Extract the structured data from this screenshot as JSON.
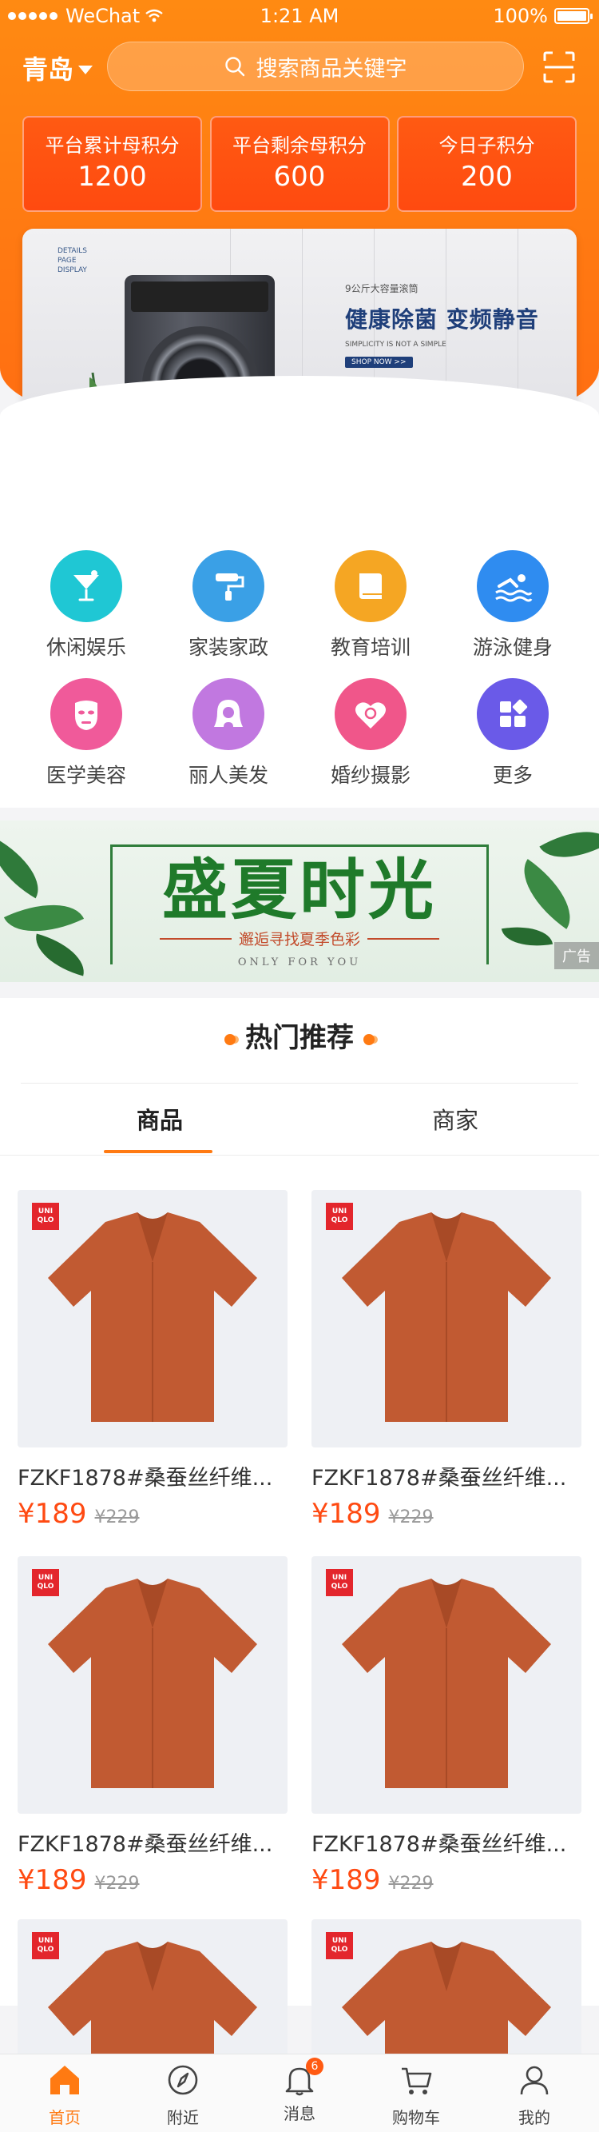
{
  "status_bar": {
    "carrier": "WeChat",
    "time": "1:21 AM",
    "battery": "100%"
  },
  "header": {
    "city": "青岛",
    "search_placeholder": "搜索商品关键字",
    "icons": {
      "search": "search-icon",
      "scan": "scan-icon",
      "dropdown": "triangle-down-icon"
    }
  },
  "points": [
    {
      "label": "平台累计母积分",
      "value": "1200"
    },
    {
      "label": "平台剩余母积分",
      "value": "600"
    },
    {
      "label": "今日子积分",
      "value": "200"
    }
  ],
  "banner": {
    "corner_text_1": "DETAILS",
    "corner_text_2": "PAGE",
    "corner_text_3": "DISPLAY",
    "small_line": "9公斤大容量滚筒",
    "slogan": "健康除菌 变频静音",
    "slogan_en": "SIMPLICITY IS NOT A SIMPLE",
    "button": "SHOP NOW >>"
  },
  "categories": [
    {
      "name": "休闲娱乐",
      "icon": "cocktail-icon",
      "color": "#1fc7d4"
    },
    {
      "name": "家装家政",
      "icon": "paint-roller-icon",
      "color": "#3aa0e6"
    },
    {
      "name": "教育培训",
      "icon": "book-icon",
      "color": "#f5a623"
    },
    {
      "name": "游泳健身",
      "icon": "swimmer-icon",
      "color": "#2f8cf0"
    },
    {
      "name": "医学美容",
      "icon": "face-mask-icon",
      "color": "#f05a9a"
    },
    {
      "name": "丽人美发",
      "icon": "woman-hair-icon",
      "color": "#c178e0"
    },
    {
      "name": "婚纱摄影",
      "icon": "heart-camera-icon",
      "color": "#f0568a"
    },
    {
      "name": "更多",
      "icon": "grid-more-icon",
      "color": "#6a5ae8"
    }
  ],
  "ad": {
    "title": "盛夏时光",
    "subtitle": "邂逅寻找夏季色彩",
    "subtitle_en": "ONLY FOR YOU",
    "badge": "广告"
  },
  "hot": {
    "title": "热门推荐",
    "tabs": [
      "商品",
      "商家"
    ],
    "active_tab": "商品",
    "products": [
      {
        "name": "FZKF1878#桑蚕丝纤维...",
        "price": "¥189",
        "old_price": "¥229",
        "brand": "UNI QLO"
      },
      {
        "name": "FZKF1878#桑蚕丝纤维...",
        "price": "¥189",
        "old_price": "¥229",
        "brand": "UNI QLO"
      },
      {
        "name": "FZKF1878#桑蚕丝纤维...",
        "price": "¥189",
        "old_price": "¥229",
        "brand": "UNI QLO"
      },
      {
        "name": "FZKF1878#桑蚕丝纤维...",
        "price": "¥189",
        "old_price": "¥229",
        "brand": "UNI QLO"
      },
      {
        "name": "",
        "price": "",
        "old_price": "",
        "brand": "UNI QLO"
      },
      {
        "name": "",
        "price": "",
        "old_price": "",
        "brand": "UNI QLO"
      }
    ]
  },
  "tabbar": {
    "items": [
      {
        "label": "首页",
        "icon": "home-icon"
      },
      {
        "label": "附近",
        "icon": "compass-icon"
      },
      {
        "label": "消息",
        "icon": "bell-icon",
        "badge": "6"
      },
      {
        "label": "购物车",
        "icon": "cart-icon"
      },
      {
        "label": "我的",
        "icon": "user-icon"
      }
    ],
    "active": "首页"
  },
  "colors": {
    "brand_orange": "#ff7a12",
    "price_red": "#ff4a12",
    "ad_green": "#1f7a2a"
  }
}
